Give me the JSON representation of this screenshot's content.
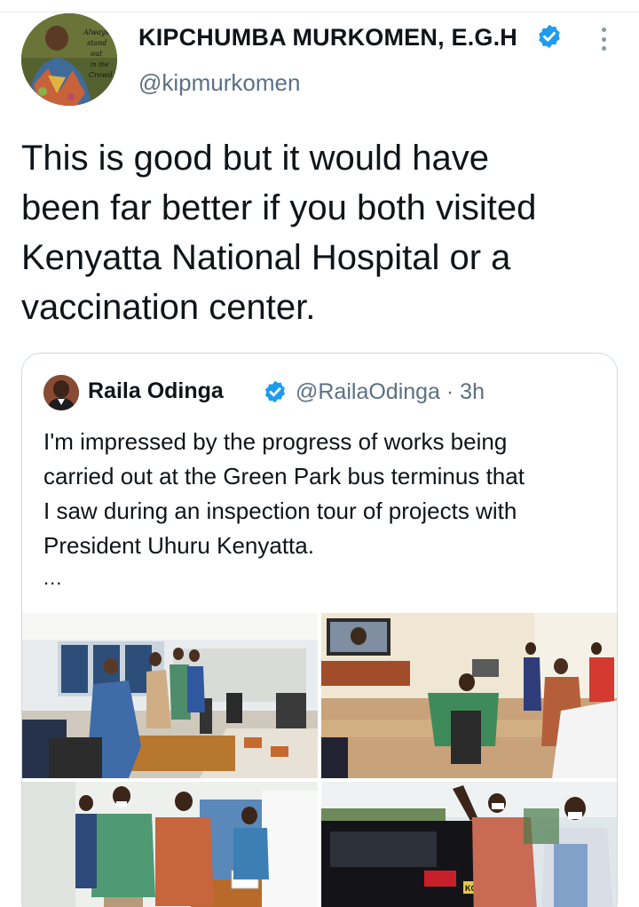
{
  "tweet": {
    "author": {
      "display_name": "KIPCHUMBA MURKOMEN, E.G.H",
      "handle": "@kipmurkomen",
      "verified": true,
      "avatar_caption": "Always stand out in the crowd"
    },
    "text_lines": [
      "This is good but it would have",
      "been far better if you both visited",
      "Kenyatta National Hospital or a",
      "vaccination center."
    ]
  },
  "quote": {
    "author": {
      "display_name": "Raila Odinga",
      "handle_time": "@RailaOdinga · 3h",
      "verified": true
    },
    "text_lines": [
      "I'm impressed by the progress of works being",
      "carried out at the Green Park bus terminus that",
      "I saw during an inspection tour of projects with",
      "President Uhuru Kenyatta."
    ],
    "ellipsis": "...",
    "photos": [
      {
        "name": "photo-office-inspection"
      },
      {
        "name": "photo-video-conference-room"
      },
      {
        "name": "photo-medical-room"
      },
      {
        "name": "photo-outdoor-wave"
      }
    ],
    "photo_badge_text": "KCR"
  },
  "colors": {
    "verified": "#1d9bf0",
    "text": "#0f1419",
    "secondary": "#5b7083",
    "border": "#cfd9de"
  }
}
